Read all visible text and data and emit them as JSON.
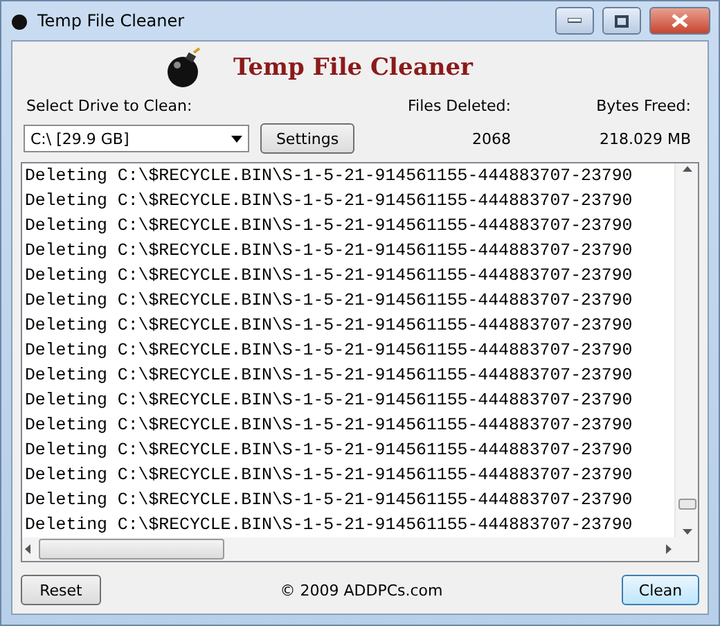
{
  "window": {
    "title": "Temp File Cleaner"
  },
  "banner": {
    "title": "Temp File Cleaner"
  },
  "drive": {
    "label": "Select Drive to Clean:",
    "value": "C:\\ [29.9 GB]"
  },
  "settings_button": "Settings",
  "stats": [
    {
      "label": "Files Deleted:",
      "value": "2068"
    },
    {
      "label": "Bytes Freed:",
      "value": "218.029 MB"
    }
  ],
  "log": [
    "Deleting C:\\$RECYCLE.BIN\\S-1-5-21-914561155-444883707-23790",
    "Deleting C:\\$RECYCLE.BIN\\S-1-5-21-914561155-444883707-23790",
    "Deleting C:\\$RECYCLE.BIN\\S-1-5-21-914561155-444883707-23790",
    "Deleting C:\\$RECYCLE.BIN\\S-1-5-21-914561155-444883707-23790",
    "Deleting C:\\$RECYCLE.BIN\\S-1-5-21-914561155-444883707-23790",
    "Deleting C:\\$RECYCLE.BIN\\S-1-5-21-914561155-444883707-23790",
    "Deleting C:\\$RECYCLE.BIN\\S-1-5-21-914561155-444883707-23790",
    "Deleting C:\\$RECYCLE.BIN\\S-1-5-21-914561155-444883707-23790",
    "Deleting C:\\$RECYCLE.BIN\\S-1-5-21-914561155-444883707-23790",
    "Deleting C:\\$RECYCLE.BIN\\S-1-5-21-914561155-444883707-23790",
    "Deleting C:\\$RECYCLE.BIN\\S-1-5-21-914561155-444883707-23790",
    "Deleting C:\\$RECYCLE.BIN\\S-1-5-21-914561155-444883707-23790",
    "Deleting C:\\$RECYCLE.BIN\\S-1-5-21-914561155-444883707-23790",
    "Deleting C:\\$RECYCLE.BIN\\S-1-5-21-914561155-444883707-23790",
    "Deleting C:\\$RECYCLE.BIN\\S-1-5-21-914561155-444883707-23790"
  ],
  "footer": {
    "reset": "Reset",
    "copyright": "© 2009 ADDPCs.com",
    "clean": "Clean"
  }
}
